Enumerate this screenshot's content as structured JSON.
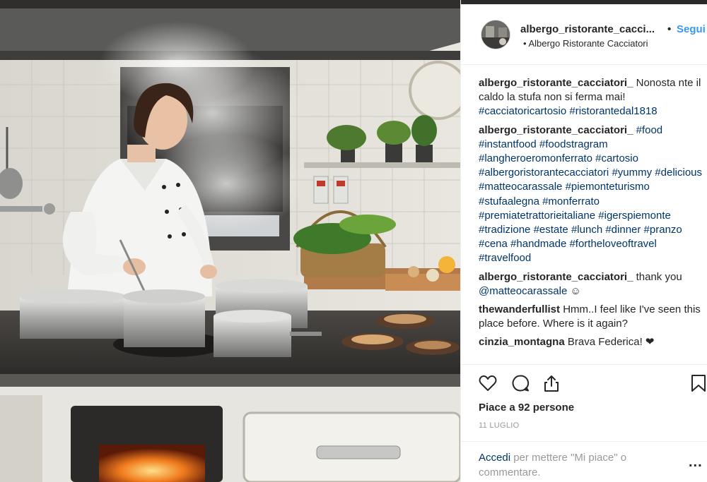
{
  "post": {
    "photo_alt": "Chef stirring pots on a wood-burning stove",
    "header": {
      "username": "albergo_ristorante_cacci...",
      "separator": "•",
      "follow_label": "Segui",
      "location": "• Albergo Ristorante Cacciatori"
    },
    "comments": [
      {
        "author": "albergo_ristorante_cacciatori_",
        "parts": [
          {
            "t": "Nonosta nte il caldo la stufa non si ferma mai! "
          },
          {
            "t": "#cacciatoricartosio",
            "tag": true
          },
          {
            "t": " "
          },
          {
            "t": "#ristorantedal1818",
            "tag": true
          }
        ]
      },
      {
        "author": "albergo_ristorante_cacciatori_",
        "parts": [
          {
            "t": "#food",
            "tag": true
          },
          {
            "t": " "
          },
          {
            "t": "#instantfood",
            "tag": true
          },
          {
            "t": " "
          },
          {
            "t": "#foodstragram",
            "tag": true
          },
          {
            "t": " "
          },
          {
            "t": "#langheroeromonferrato",
            "tag": true
          },
          {
            "t": " "
          },
          {
            "t": "#cartosio",
            "tag": true
          },
          {
            "t": " "
          },
          {
            "t": "#albergoristorantecacciatori",
            "tag": true
          },
          {
            "t": " "
          },
          {
            "t": "#yummy",
            "tag": true
          },
          {
            "t": " "
          },
          {
            "t": "#delicious",
            "tag": true
          },
          {
            "t": " "
          },
          {
            "t": "#matteocarassale",
            "tag": true
          },
          {
            "t": " "
          },
          {
            "t": "#piemonteturismo",
            "tag": true
          },
          {
            "t": " "
          },
          {
            "t": "#stufaalegna",
            "tag": true
          },
          {
            "t": " "
          },
          {
            "t": "#monferrato",
            "tag": true
          },
          {
            "t": " "
          },
          {
            "t": "#premiatetrattorieitaliane",
            "tag": true
          },
          {
            "t": " "
          },
          {
            "t": "#igerspiemonte",
            "tag": true
          },
          {
            "t": " "
          },
          {
            "t": "#tradizione",
            "tag": true
          },
          {
            "t": " "
          },
          {
            "t": "#estate",
            "tag": true
          },
          {
            "t": " "
          },
          {
            "t": "#lunch",
            "tag": true
          },
          {
            "t": " "
          },
          {
            "t": "#dinner",
            "tag": true
          },
          {
            "t": " "
          },
          {
            "t": "#pranzo",
            "tag": true
          },
          {
            "t": " "
          },
          {
            "t": "#cena",
            "tag": true
          },
          {
            "t": " "
          },
          {
            "t": "#handmade",
            "tag": true
          },
          {
            "t": " "
          },
          {
            "t": "#fortheloveoftravel",
            "tag": true
          },
          {
            "t": " "
          },
          {
            "t": "#travelfood",
            "tag": true
          }
        ]
      },
      {
        "author": "albergo_ristorante_cacciatori_",
        "parts": [
          {
            "t": "thank you "
          },
          {
            "t": "@matteocarassale",
            "tag": true
          },
          {
            "t": " ☺"
          }
        ]
      },
      {
        "author": "thewanderfullist",
        "parts": [
          {
            "t": "Hmm..I feel like I've seen this place before. Where is it again?"
          }
        ]
      },
      {
        "author": "cinzia_montagna",
        "parts": [
          {
            "t": "Brava Federica! ❤"
          }
        ]
      }
    ],
    "actions": {
      "icons": [
        "heart-icon",
        "comment-icon",
        "share-icon",
        "bookmark-icon"
      ],
      "likes_text": "Piace a 92 persone",
      "date": "11 LUGLIO",
      "login_link": "Accedi",
      "login_rest": " per mettere \"Mi piace\" o commentare.",
      "more": "..."
    },
    "colors": {
      "link": "#3897f0",
      "hashtag": "#003569",
      "muted": "#999999",
      "text": "#262626"
    }
  }
}
